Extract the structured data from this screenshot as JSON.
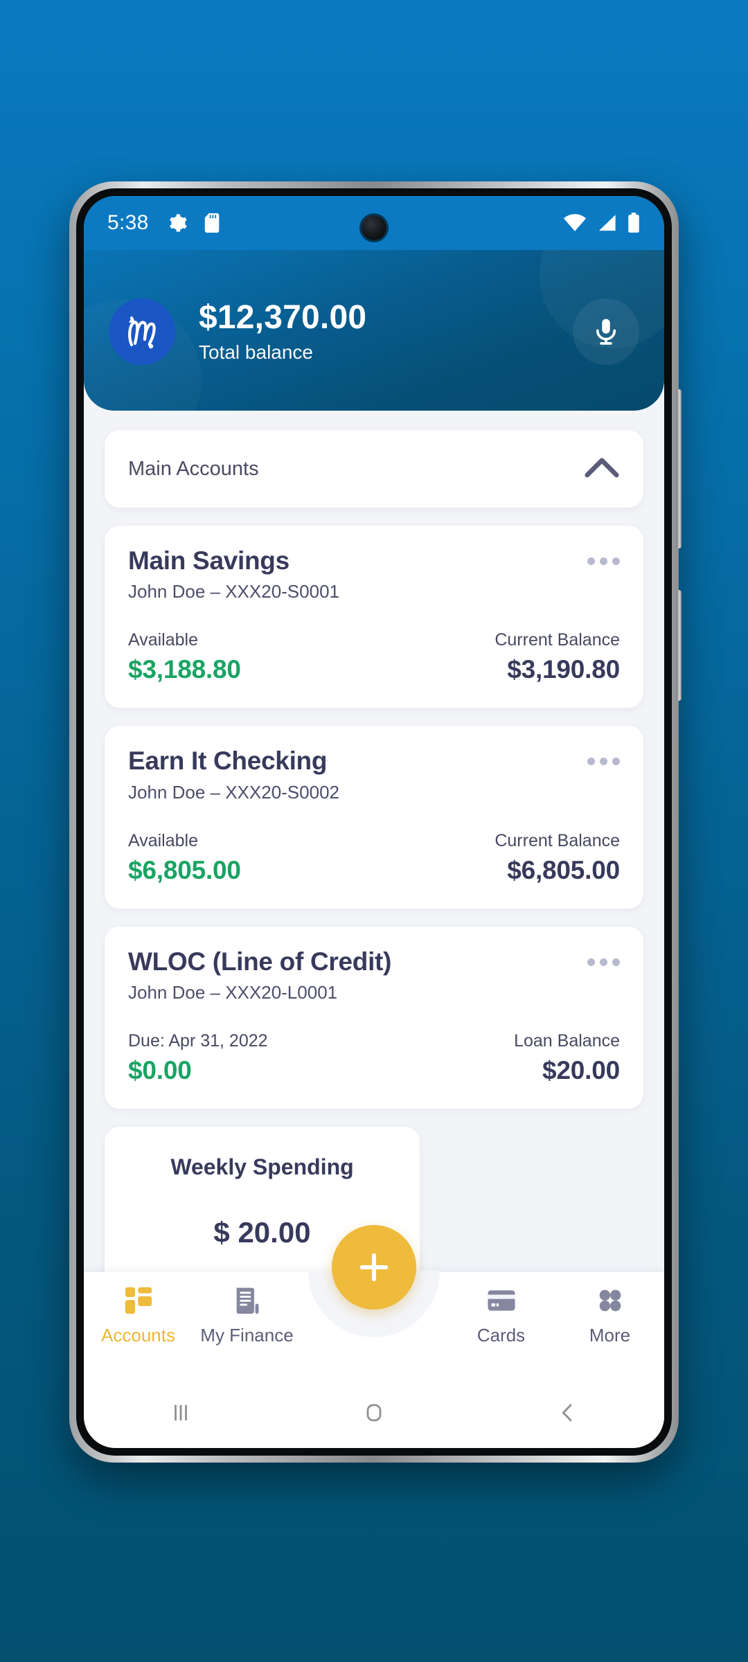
{
  "status_bar": {
    "time": "5:38",
    "left_icons": [
      "gear-icon",
      "sd-card-icon"
    ],
    "right_icons": [
      "wifi-icon",
      "cellular-signal-icon",
      "battery-icon"
    ]
  },
  "header": {
    "logo": "bank-monogram-logo",
    "total_balance_amount": "$12,370.00",
    "total_balance_label": "Total balance",
    "voice_icon": "microphone-icon"
  },
  "accounts_group": {
    "title": "Main Accounts",
    "collapse_icon": "chevron-up-icon"
  },
  "accounts": [
    {
      "name": "Main Savings",
      "subtitle": "John Doe – XXX20-S0001",
      "left_label": "Available",
      "left_value": "$3,188.80",
      "right_label": "Current Balance",
      "right_value": "$3,190.80",
      "menu_icon": "more-options-icon"
    },
    {
      "name": "Earn It Checking",
      "subtitle": "John Doe – XXX20-S0002",
      "left_label": "Available",
      "left_value": "$6,805.00",
      "right_label": "Current Balance",
      "right_value": "$6,805.00",
      "menu_icon": "more-options-icon"
    },
    {
      "name": "WLOC (Line of Credit)",
      "subtitle": "John Doe – XXX20-L0001",
      "left_label": "Due: Apr 31, 2022",
      "left_value": "$0.00",
      "right_label": "Loan Balance",
      "right_value": "$20.00",
      "menu_icon": "more-options-icon"
    }
  ],
  "weekly_spending": {
    "title": "Weekly Spending",
    "amount": "$ 20.00"
  },
  "bottom_nav": {
    "fab_label": "+",
    "fab_icon": "plus-icon",
    "items": [
      {
        "label": "Accounts",
        "icon": "grid-dashboard-icon",
        "active": true
      },
      {
        "label": "My Finance",
        "icon": "document-list-icon",
        "active": false
      },
      {
        "label": "Cards",
        "icon": "credit-card-icon",
        "active": false
      },
      {
        "label": "More",
        "icon": "four-dots-icon",
        "active": false
      }
    ]
  },
  "android_nav": {
    "recents": "recents-icon",
    "home": "home-icon",
    "back": "back-icon"
  },
  "colors": {
    "brand_blue": "#0b7ac2",
    "header_dark": "#064a6c",
    "accent_yellow": "#efbb3c",
    "positive_green": "#19a463",
    "text_dark": "#383a5c",
    "app_background": "#f2f4f8"
  }
}
